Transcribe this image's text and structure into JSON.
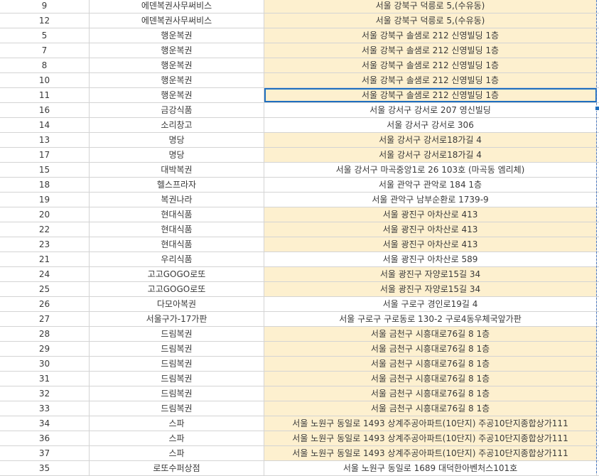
{
  "sheet": {
    "highlight_color": "#fdf0cf",
    "selection_color": "#1f6fbf",
    "rows": [
      {
        "num": "9",
        "name": "에덴복권사무써비스",
        "addr": "서울 강북구 덕릉로 5,(수유동)",
        "hl": true
      },
      {
        "num": "12",
        "name": "에덴복권사무써비스",
        "addr": "서울 강북구 덕릉로 5,(수유동)",
        "hl": true
      },
      {
        "num": "5",
        "name": "행운복권",
        "addr": "서울 강북구 솔샘로 212 신영빌딩 1층",
        "hl": true
      },
      {
        "num": "7",
        "name": "행운복권",
        "addr": "서울 강북구 솔샘로 212 신영빌딩 1층",
        "hl": true
      },
      {
        "num": "8",
        "name": "행운복권",
        "addr": "서울 강북구 솔샘로 212 신영빌딩 1층",
        "hl": true
      },
      {
        "num": "10",
        "name": "행운복권",
        "addr": "서울 강북구 솔샘로 212 신영빌딩 1층",
        "hl": true
      },
      {
        "num": "11",
        "name": "행운복권",
        "addr": "서울 강북구 솔샘로 212 신영빌딩 1층",
        "hl": true,
        "selected": true
      },
      {
        "num": "16",
        "name": "금강식품",
        "addr": "서울 강서구 강서로 207 영신빌딩",
        "hl": false
      },
      {
        "num": "14",
        "name": "소리창고",
        "addr": "서울 강서구 강서로 306",
        "hl": false
      },
      {
        "num": "13",
        "name": "명당",
        "addr": "서울 강서구 강서로18가길 4",
        "hl": true
      },
      {
        "num": "17",
        "name": "명당",
        "addr": "서울 강서구 강서로18가길 4",
        "hl": true
      },
      {
        "num": "15",
        "name": "대박복권",
        "addr": "서울 강서구 마곡중앙1로 26 103호 (마곡동 엠리체)",
        "hl": false
      },
      {
        "num": "18",
        "name": "헬스프라자",
        "addr": "서울 관악구 관악로 184 1층",
        "hl": false
      },
      {
        "num": "19",
        "name": "복권나라",
        "addr": "서울 관악구 남부순환로 1739-9",
        "hl": false
      },
      {
        "num": "20",
        "name": "현대식품",
        "addr": "서울 광진구 아차산로 413",
        "hl": true
      },
      {
        "num": "22",
        "name": "현대식품",
        "addr": "서울 광진구 아차산로 413",
        "hl": true
      },
      {
        "num": "23",
        "name": "현대식품",
        "addr": "서울 광진구 아차산로 413",
        "hl": true
      },
      {
        "num": "21",
        "name": "우리식품",
        "addr": "서울 광진구 아차산로 589",
        "hl": false
      },
      {
        "num": "24",
        "name": "고고GOGO로또",
        "addr": "서울 광진구 자양로15길 34",
        "hl": true
      },
      {
        "num": "25",
        "name": "고고GOGO로또",
        "addr": "서울 광진구 자양로15길 34",
        "hl": true
      },
      {
        "num": "26",
        "name": "다모아복권",
        "addr": "서울 구로구 경인로19길 4",
        "hl": false
      },
      {
        "num": "27",
        "name": "서울구가-17가판",
        "addr": "서울 구로구 구로동로 130-2 구로4동우체국앞가판",
        "hl": false
      },
      {
        "num": "28",
        "name": "드림복권",
        "addr": "서울 금천구 시흥대로76길 8 1층",
        "hl": true
      },
      {
        "num": "29",
        "name": "드림복권",
        "addr": "서울 금천구 시흥대로76길 8 1층",
        "hl": true
      },
      {
        "num": "30",
        "name": "드림복권",
        "addr": "서울 금천구 시흥대로76길 8 1층",
        "hl": true
      },
      {
        "num": "31",
        "name": "드림복권",
        "addr": "서울 금천구 시흥대로76길 8 1층",
        "hl": true
      },
      {
        "num": "32",
        "name": "드림복권",
        "addr": "서울 금천구 시흥대로76길 8 1층",
        "hl": true
      },
      {
        "num": "33",
        "name": "드림복권",
        "addr": "서울 금천구 시흥대로76길 8 1층",
        "hl": true
      },
      {
        "num": "34",
        "name": "스파",
        "addr": "서울 노원구 동일로 1493 상계주공아파트(10단지) 주공10단지종합상가111",
        "hl": true
      },
      {
        "num": "36",
        "name": "스파",
        "addr": "서울 노원구 동일로 1493 상계주공아파트(10단지) 주공10단지종합상가111",
        "hl": true
      },
      {
        "num": "37",
        "name": "스파",
        "addr": "서울 노원구 동일로 1493 상계주공아파트(10단지) 주공10단지종합상가111",
        "hl": true
      },
      {
        "num": "35",
        "name": "로또수퍼상점",
        "addr": "서울 노원구 동일로 1689 대덕한아벤처스101호",
        "hl": false
      }
    ]
  }
}
